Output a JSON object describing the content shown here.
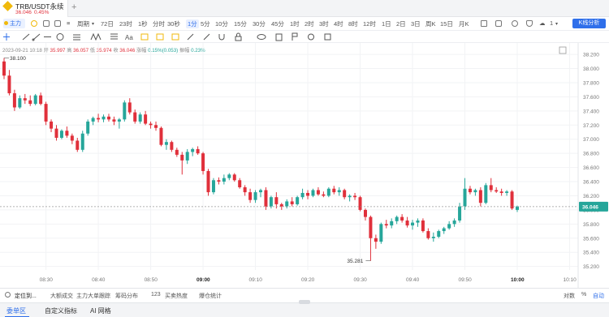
{
  "tab": {
    "title": "TRB/USDT永续",
    "price": "36.046",
    "change": "0.45%",
    "add": "+"
  },
  "toolbar": {
    "mode_label": "主力",
    "period_label": "周期",
    "timeframes": [
      "72日",
      "23时",
      "1秒",
      "分时",
      "30秒",
      "1分",
      "5分",
      "10分",
      "15分",
      "30分",
      "45分",
      "1时",
      "2时",
      "3时",
      "4时",
      "8时",
      "12时",
      "1日",
      "2日",
      "3日",
      "周K",
      "15日",
      "月K"
    ],
    "active_timeframe": "1分",
    "right_label": "1",
    "kline_button": "K线分析"
  },
  "ohlc": {
    "date": "2023-09-21 10:18",
    "open_label": "开",
    "open": "35.997",
    "high_label": "高",
    "high": "36.057",
    "low_label": "低",
    "low": "35.974",
    "close_label": "收",
    "close": "36.046",
    "change_label": "涨幅",
    "change": "0.15%(0.053)",
    "amp_label": "振幅",
    "amp": "0.23%"
  },
  "chart_data": {
    "type": "candlestick",
    "y_axis_labels": [
      "38.200",
      "38.000",
      "37.800",
      "37.600",
      "37.400",
      "37.200",
      "37.000",
      "36.800",
      "36.600",
      "36.400",
      "36.200",
      "36.000",
      "35.800",
      "35.600",
      "35.400",
      "35.200"
    ],
    "ylim": [
      35.15,
      38.27
    ],
    "x_axis_labels": [
      "08:30",
      "08:40",
      "08:50",
      "09:00",
      "09:10",
      "09:20",
      "09:30",
      "09:40",
      "09:50",
      "10:00",
      "10:10",
      "10:20"
    ],
    "bold_x_labels": [
      "09:00",
      "10:00"
    ],
    "start_time": "08:22",
    "max_label": "38.100",
    "min_label": "35.281",
    "last_price": "36.046",
    "colors": {
      "up": "#26a69a",
      "down": "#e0303b",
      "price_tag": "#26a69a"
    },
    "candles": [
      [
        38.1,
        38.15,
        37.85,
        37.9
      ],
      [
        37.9,
        37.98,
        37.62,
        37.65
      ],
      [
        37.65,
        37.7,
        37.4,
        37.45
      ],
      [
        37.45,
        37.62,
        37.43,
        37.58
      ],
      [
        37.58,
        37.64,
        37.5,
        37.55
      ],
      [
        37.55,
        37.62,
        37.47,
        37.5
      ],
      [
        37.5,
        37.64,
        37.48,
        37.62
      ],
      [
        37.62,
        37.66,
        37.48,
        37.5
      ],
      [
        37.5,
        37.53,
        37.2,
        37.25
      ],
      [
        37.25,
        37.28,
        37.1,
        37.15
      ],
      [
        37.15,
        37.2,
        36.98,
        37.02
      ],
      [
        37.02,
        37.14,
        37.0,
        37.12
      ],
      [
        37.12,
        37.18,
        37.02,
        37.05
      ],
      [
        37.05,
        37.08,
        36.93,
        36.98
      ],
      [
        36.98,
        37.02,
        36.82,
        36.85
      ],
      [
        36.85,
        37.12,
        36.82,
        37.08
      ],
      [
        37.08,
        37.28,
        37.05,
        37.25
      ],
      [
        37.25,
        37.32,
        37.2,
        37.3
      ],
      [
        37.3,
        37.36,
        37.24,
        37.28
      ],
      [
        37.28,
        37.35,
        37.24,
        37.32
      ],
      [
        37.32,
        37.36,
        37.25,
        37.28
      ],
      [
        37.28,
        37.32,
        37.2,
        37.25
      ],
      [
        37.25,
        37.3,
        37.15,
        37.28
      ],
      [
        37.28,
        37.55,
        37.25,
        37.52
      ],
      [
        37.52,
        37.58,
        37.35,
        37.38
      ],
      [
        37.38,
        37.42,
        37.22,
        37.25
      ],
      [
        37.25,
        37.38,
        37.22,
        37.35
      ],
      [
        37.35,
        37.4,
        37.2,
        37.22
      ],
      [
        37.22,
        37.25,
        37.15,
        37.2
      ],
      [
        37.2,
        37.25,
        37.12,
        37.16
      ],
      [
        37.16,
        37.18,
        36.9,
        36.92
      ],
      [
        36.92,
        37.0,
        36.85,
        36.96
      ],
      [
        36.96,
        36.98,
        36.82,
        36.85
      ],
      [
        36.85,
        36.88,
        36.75,
        36.78
      ],
      [
        36.78,
        36.82,
        36.5,
        36.7
      ],
      [
        36.7,
        36.86,
        36.65,
        36.82
      ],
      [
        36.82,
        36.88,
        36.76,
        36.86
      ],
      [
        36.86,
        36.9,
        36.78,
        36.8
      ],
      [
        36.8,
        36.82,
        36.5,
        36.55
      ],
      [
        36.55,
        36.58,
        36.2,
        36.25
      ],
      [
        36.25,
        36.45,
        36.22,
        36.42
      ],
      [
        36.42,
        36.46,
        36.36,
        36.4
      ],
      [
        36.4,
        36.5,
        36.36,
        36.45
      ],
      [
        36.45,
        36.52,
        36.42,
        36.5
      ],
      [
        36.5,
        36.52,
        36.4,
        36.42
      ],
      [
        36.42,
        36.45,
        36.3,
        36.32
      ],
      [
        36.32,
        36.35,
        36.2,
        36.25
      ],
      [
        36.25,
        36.3,
        36.1,
        36.14
      ],
      [
        36.14,
        36.28,
        36.1,
        36.25
      ],
      [
        36.25,
        36.3,
        36.18,
        36.28
      ],
      [
        36.28,
        36.32,
        36.0,
        36.05
      ],
      [
        36.05,
        36.2,
        36.02,
        36.18
      ],
      [
        36.18,
        36.25,
        36.02,
        36.08
      ],
      [
        36.08,
        36.1,
        36.0,
        36.05
      ],
      [
        36.05,
        36.15,
        36.02,
        36.12
      ],
      [
        36.12,
        36.18,
        36.05,
        36.08
      ],
      [
        36.08,
        36.2,
        36.06,
        36.18
      ],
      [
        36.18,
        36.3,
        36.15,
        36.24
      ],
      [
        36.24,
        36.28,
        36.15,
        36.2
      ],
      [
        36.2,
        36.3,
        36.18,
        36.28
      ],
      [
        36.28,
        36.32,
        36.2,
        36.22
      ],
      [
        36.22,
        36.26,
        36.18,
        36.2
      ],
      [
        36.2,
        36.32,
        36.18,
        36.3
      ],
      [
        36.3,
        36.34,
        36.22,
        36.25
      ],
      [
        36.25,
        36.32,
        36.2,
        36.28
      ],
      [
        36.28,
        36.3,
        36.15,
        36.18
      ],
      [
        36.18,
        36.22,
        36.12,
        36.2
      ],
      [
        36.2,
        36.24,
        36.14,
        36.18
      ],
      [
        36.18,
        36.2,
        35.98,
        36.0
      ],
      [
        36.0,
        36.02,
        35.85,
        35.9
      ],
      [
        35.9,
        35.92,
        35.28,
        35.6
      ],
      [
        35.6,
        35.65,
        35.45,
        35.55
      ],
      [
        35.55,
        35.82,
        35.52,
        35.8
      ],
      [
        35.8,
        35.86,
        35.74,
        35.78
      ],
      [
        35.78,
        35.88,
        35.74,
        35.84
      ],
      [
        35.84,
        35.92,
        35.8,
        35.9
      ],
      [
        35.9,
        35.94,
        35.82,
        35.85
      ],
      [
        35.85,
        35.9,
        35.75,
        35.78
      ],
      [
        35.78,
        35.86,
        35.72,
        35.82
      ],
      [
        35.82,
        35.88,
        35.76,
        35.85
      ],
      [
        35.85,
        35.88,
        35.68,
        35.7
      ],
      [
        35.7,
        35.74,
        35.58,
        35.6
      ],
      [
        35.6,
        35.68,
        35.55,
        35.62
      ],
      [
        35.62,
        35.72,
        35.6,
        35.7
      ],
      [
        35.7,
        35.76,
        35.66,
        35.74
      ],
      [
        35.74,
        35.84,
        35.72,
        35.8
      ],
      [
        35.8,
        35.88,
        35.76,
        35.85
      ],
      [
        35.85,
        36.1,
        35.82,
        36.05
      ],
      [
        36.05,
        36.45,
        36.0,
        36.3
      ],
      [
        36.3,
        36.34,
        36.22,
        36.25
      ],
      [
        36.25,
        36.3,
        36.2,
        36.28
      ],
      [
        36.28,
        36.32,
        36.05,
        36.1
      ],
      [
        36.1,
        36.38,
        36.08,
        36.35
      ],
      [
        36.35,
        36.45,
        36.25,
        36.28
      ],
      [
        36.28,
        36.32,
        36.24,
        36.26
      ],
      [
        36.26,
        36.3,
        36.2,
        36.24
      ],
      [
        36.24,
        36.28,
        36.2,
        36.26
      ],
      [
        36.26,
        36.28,
        36.0,
        36.02
      ],
      [
        36.0,
        36.06,
        35.97,
        36.05
      ]
    ]
  },
  "bottom_tools": [
    "定位到...",
    "大额成交",
    "主力大单跟踪",
    "筹码分布",
    "123",
    "买卖热度",
    "爆仓统计"
  ],
  "bottom_right": {
    "log": "对数",
    "pct": "%",
    "auto": "自动"
  },
  "footer_tabs": [
    "委单区",
    "自定义指标",
    "AI 网格"
  ]
}
